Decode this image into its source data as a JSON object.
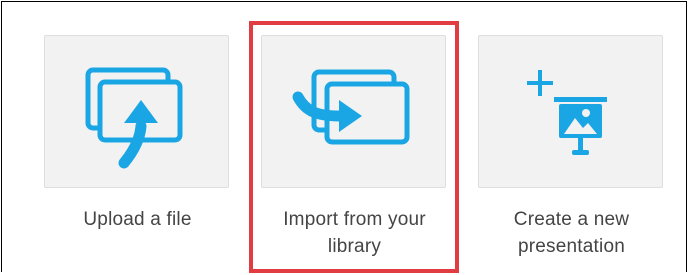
{
  "options": [
    {
      "id": "upload",
      "label": "Upload a file",
      "icon": "upload-file-icon"
    },
    {
      "id": "import",
      "label": "Import from your library",
      "icon": "import-library-icon",
      "highlighted": true
    },
    {
      "id": "create",
      "label": "Create a new presentation",
      "icon": "create-presentation-icon"
    }
  ],
  "colors": {
    "icon_blue": "#1aa6e4",
    "tile_bg": "#f2f2f2",
    "highlight_border": "#e03c41",
    "label_text": "#444444"
  }
}
